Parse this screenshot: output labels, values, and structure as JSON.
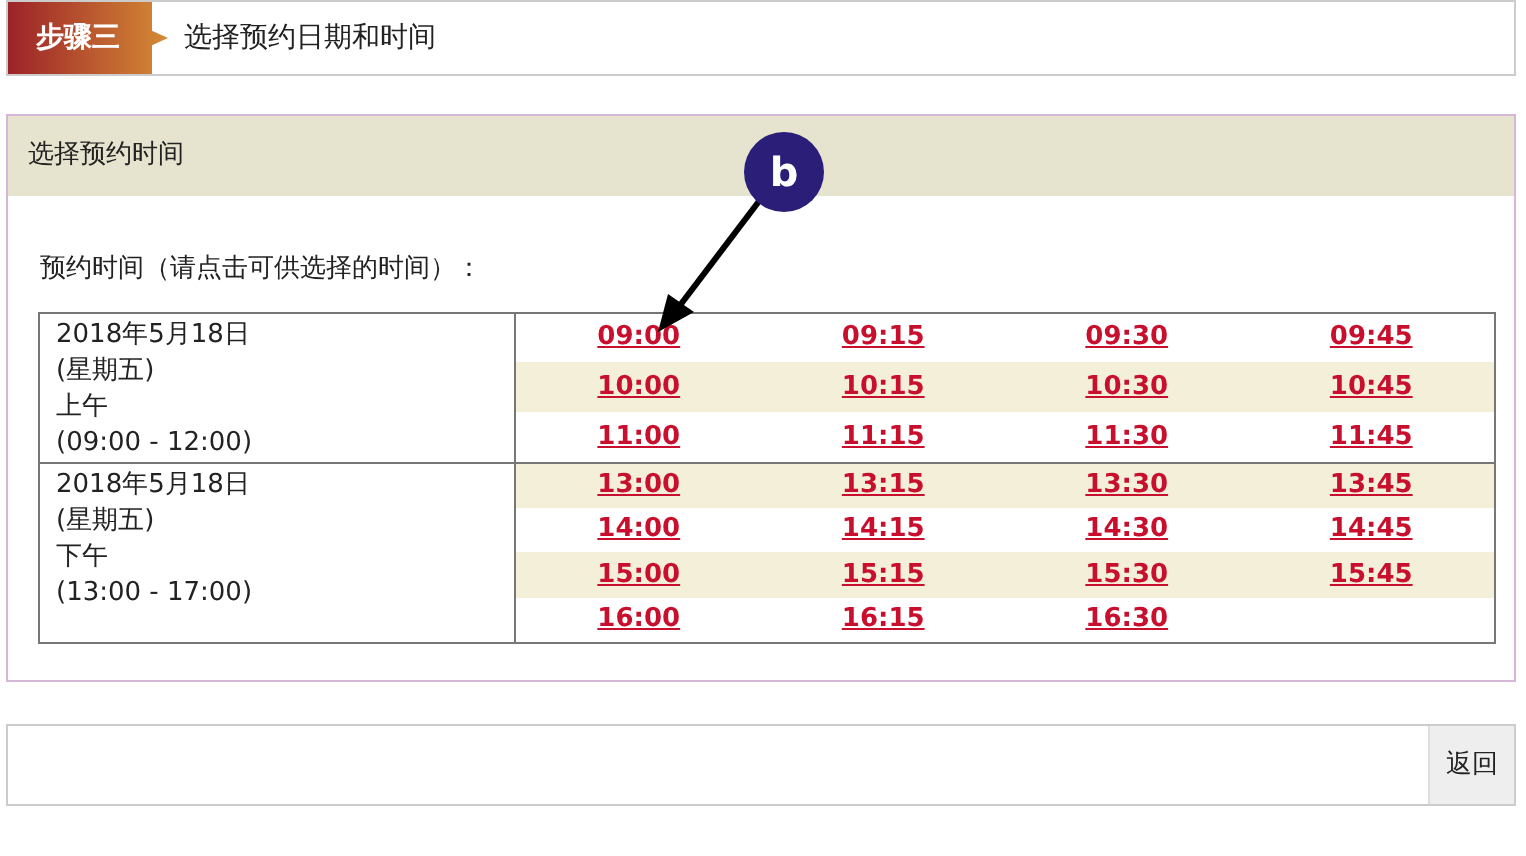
{
  "step": {
    "badge": "步骤三",
    "title": "选择预约日期和时间"
  },
  "panel": {
    "title": "选择预约时间",
    "prompt": "预约时间（请点击可供选择的时间）：",
    "groups": [
      {
        "date": "2018年5月18日",
        "weekday": "(星期五)",
        "period": "上午",
        "range": "(09:00 - 12:00)",
        "rows": [
          {
            "shaded": false,
            "times": [
              "09:00",
              "09:15",
              "09:30",
              "09:45"
            ]
          },
          {
            "shaded": true,
            "times": [
              "10:00",
              "10:15",
              "10:30",
              "10:45"
            ]
          },
          {
            "shaded": false,
            "times": [
              "11:00",
              "11:15",
              "11:30",
              "11:45"
            ]
          }
        ]
      },
      {
        "date": "2018年5月18日",
        "weekday": "(星期五)",
        "period": "下午",
        "range": "(13:00 - 17:00)",
        "rows": [
          {
            "shaded": true,
            "times": [
              "13:00",
              "13:15",
              "13:30",
              "13:45"
            ]
          },
          {
            "shaded": false,
            "times": [
              "14:00",
              "14:15",
              "14:30",
              "14:45"
            ]
          },
          {
            "shaded": true,
            "times": [
              "15:00",
              "15:15",
              "15:30",
              "15:45"
            ]
          },
          {
            "shaded": false,
            "times": [
              "16:00",
              "16:15",
              "16:30"
            ]
          }
        ]
      }
    ]
  },
  "annotation": {
    "label": "b"
  },
  "footer": {
    "back_button": "返回"
  }
}
